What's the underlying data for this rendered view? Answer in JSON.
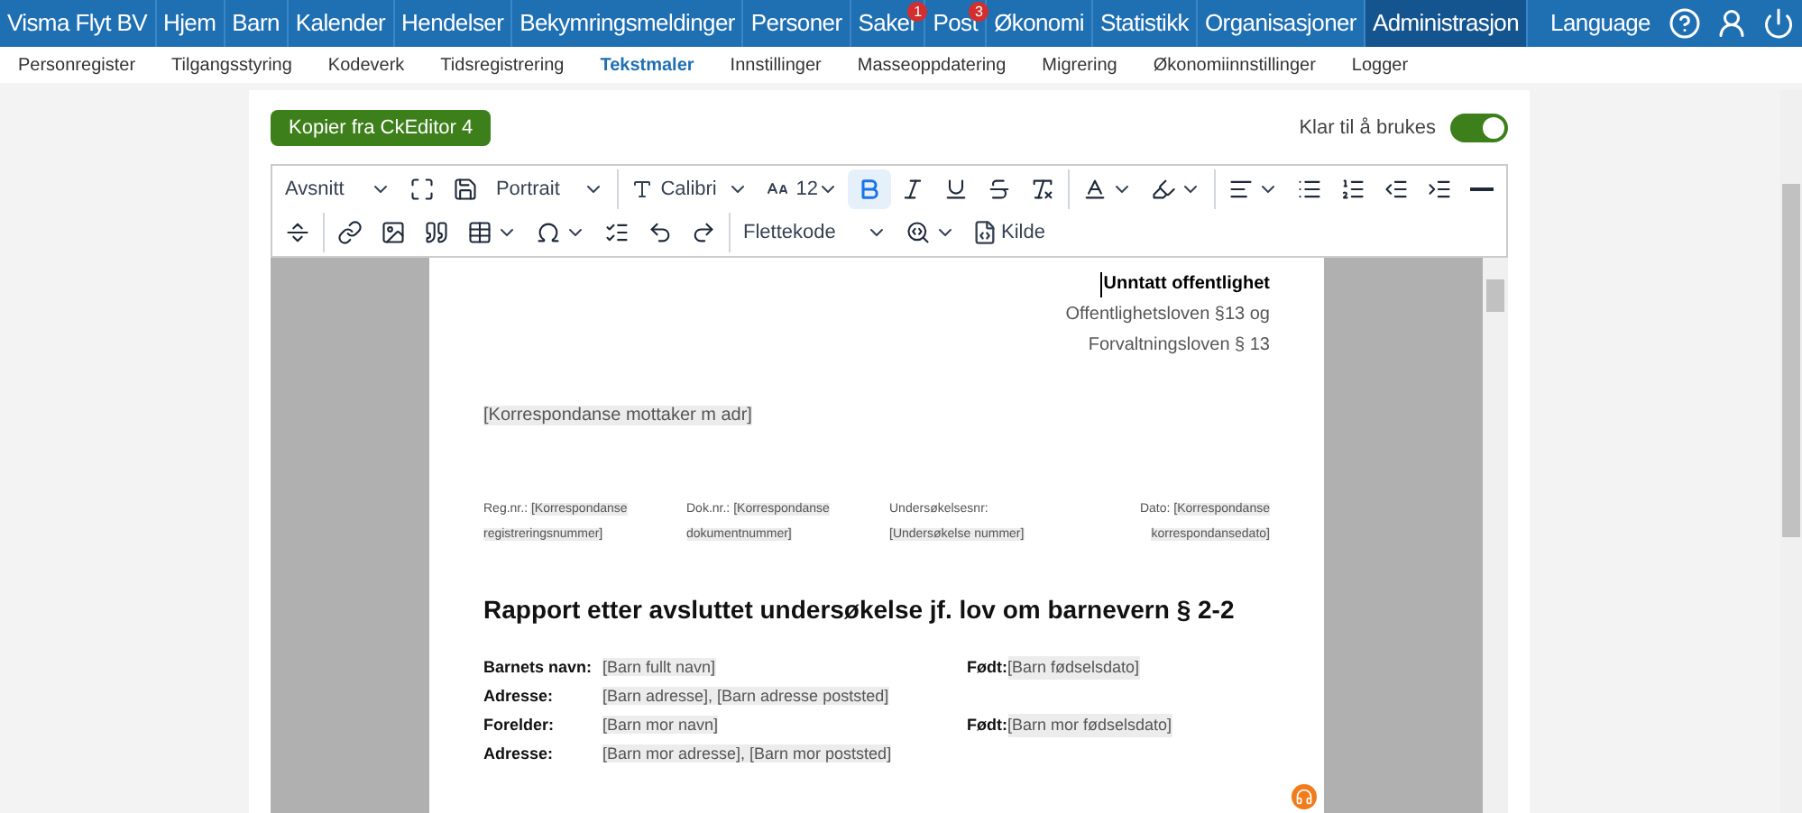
{
  "top_nav": {
    "items": [
      {
        "label": "Visma Flyt BV",
        "selected": false
      },
      {
        "label": "Hjem",
        "selected": false
      },
      {
        "label": "Barn",
        "selected": false
      },
      {
        "label": "Kalender",
        "selected": false
      },
      {
        "label": "Hendelser",
        "selected": false
      },
      {
        "label": "Bekymringsmeldinger",
        "selected": false
      },
      {
        "label": "Personer",
        "selected": false
      },
      {
        "label": "Saker",
        "selected": false,
        "badge": "1"
      },
      {
        "label": "Post",
        "selected": false,
        "badge": "3"
      },
      {
        "label": "Økonomi",
        "selected": false
      },
      {
        "label": "Statistikk",
        "selected": false
      },
      {
        "label": "Organisasjoner",
        "selected": false
      },
      {
        "label": "Administrasjon",
        "selected": true
      }
    ],
    "language": "Language"
  },
  "sub_nav": {
    "items": [
      {
        "label": "Personregister",
        "selected": false
      },
      {
        "label": "Tilgangsstyring",
        "selected": false
      },
      {
        "label": "Kodeverk",
        "selected": false
      },
      {
        "label": "Tidsregistrering",
        "selected": false
      },
      {
        "label": "Tekstmaler",
        "selected": true
      },
      {
        "label": "Innstillinger",
        "selected": false
      },
      {
        "label": "Masseoppdatering",
        "selected": false
      },
      {
        "label": "Migrering",
        "selected": false
      },
      {
        "label": "Økonomiinnstillinger",
        "selected": false
      },
      {
        "label": "Logger",
        "selected": false
      }
    ]
  },
  "copy_button": "Kopier fra CkEditor 4",
  "ready_toggle": {
    "label": "Klar til å brukes",
    "on": true
  },
  "toolbar": {
    "format": "Avsnitt",
    "orientation": "Portrait",
    "font": "Calibri",
    "size": "12",
    "bold_active": true,
    "merge_code": "Flettekode",
    "source": "Kilde"
  },
  "document": {
    "header_lines": [
      "**Unntatt offentlighet**",
      "Offentlighetsloven §13 og",
      "Forvaltningsloven § 13"
    ],
    "recipient": "[Korrespondanse mottaker m adr]",
    "meta": [
      {
        "label": "Reg.nr.:",
        "value": "[Korrespondanse registreringsnummer]"
      },
      {
        "label": "Dok.nr.:",
        "value": "[Korrespondanse dokumentnummer]"
      },
      {
        "label": "Undersøkelsesnr:",
        "value": "[Undersøkelse nummer]"
      },
      {
        "label": "Dato:",
        "value": "[Korrespondanse korrespondansedato]"
      }
    ],
    "title": "Rapport etter avsluttet undersøkelse jf. lov om barnevern § 2-2",
    "fields": [
      {
        "label": "Barnets navn:",
        "values": [
          "[Barn fullt navn]"
        ],
        "born_label": "Født:",
        "born_value": "[Barn fødselsdato]"
      },
      {
        "label": "Adresse:",
        "values": [
          "[Barn adresse], [Barn adresse poststed]"
        ]
      },
      {
        "label": "Forelder:",
        "values": [
          "[Barn mor navn]"
        ],
        "born_label": "Født:",
        "born_value": "[Barn mor fødselsdato]"
      },
      {
        "label": "Adresse:",
        "values": [
          "[Barn mor adresse], [Barn mor poststed]"
        ]
      }
    ]
  }
}
